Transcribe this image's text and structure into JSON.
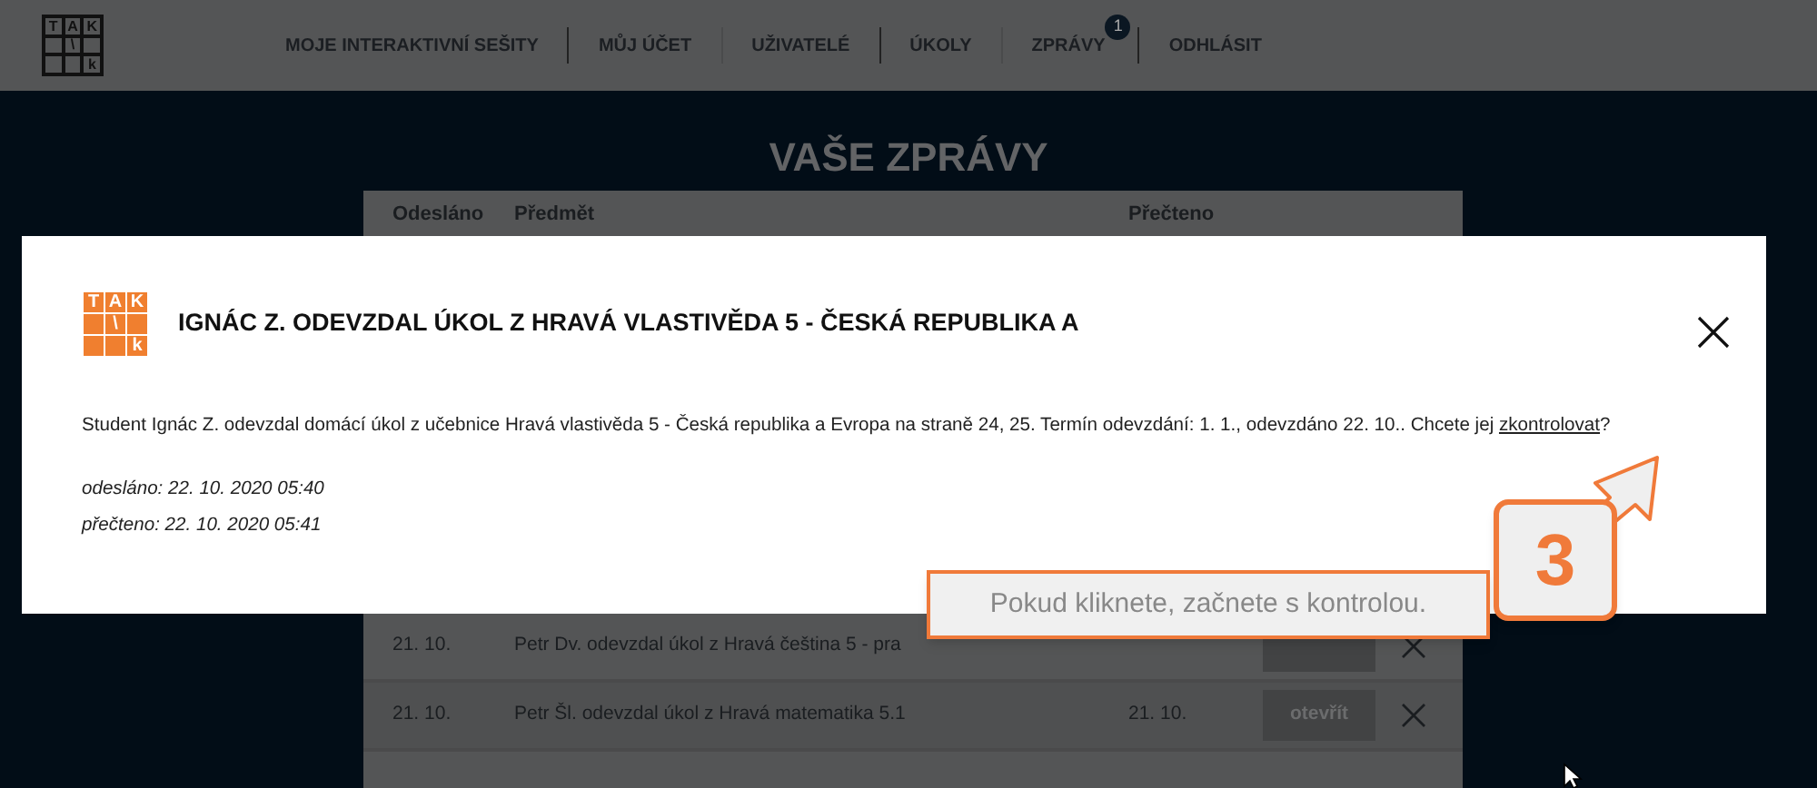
{
  "logo": {
    "cells": [
      "T",
      "A",
      "K",
      "",
      "\\",
      "",
      "",
      "",
      "k"
    ]
  },
  "modal_logo": {
    "cells": [
      "T",
      "A",
      "K",
      "",
      "\\",
      "",
      "",
      "",
      "k"
    ]
  },
  "nav": [
    {
      "label": "MOJE INTERAKTIVNÍ SEŠITY"
    },
    {
      "label": "MŮJ ÚČET"
    },
    {
      "label": "UŽIVATELÉ"
    },
    {
      "label": "ÚKOLY"
    },
    {
      "label": "ZPRÁVY",
      "badge": "1"
    },
    {
      "label": "ODHLÁSIT"
    }
  ],
  "page_title": "VAŠE ZPRÁVY",
  "table": {
    "columns": [
      "Odesláno",
      "Předmět",
      "Přečteno"
    ],
    "rows": [
      {
        "sent": "21. 10.",
        "subject": "Petr Dv. odevzdal úkol z Hravá čeština 5 - pra"
      },
      {
        "sent": "21. 10.",
        "subject": "Petr Šl. odevzdal úkol z Hravá matematika 5.1",
        "read": "21. 10.",
        "button": "otevřít"
      }
    ]
  },
  "modal": {
    "title": "IGNÁC Z. ODEVZDAL ÚKOL Z HRAVÁ VLASTIVĚDA 5 - ČESKÁ REPUBLIKA A",
    "message_before": "Student Ignác Z. odevzdal domácí úkol z učebnice Hravá vlastivěda 5 - Česká republika a Evropa na straně 24, 25. Termín odevzdání: 1. 1., odevzdáno 22. 10.. Chcete jej ",
    "link": "zkontrolovat",
    "message_after": "?",
    "sent": "odesláno: 22. 10. 2020 05:40",
    "read": "přečteno: 22. 10. 2020 05:41"
  },
  "tooltip": "Pokud kliknete, začnete s kontrolou.",
  "step_badge": "3"
}
